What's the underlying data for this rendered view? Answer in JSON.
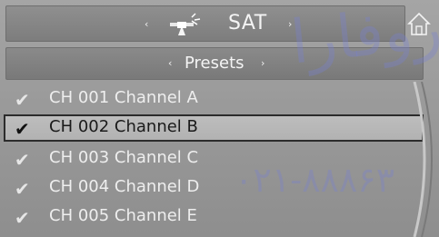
{
  "header": {
    "source_label": "SAT",
    "prev_arrow": "‹",
    "next_arrow": "›"
  },
  "presets": {
    "label": "Presets",
    "prev_arrow": "‹",
    "next_arrow": "›"
  },
  "channels": [
    {
      "label": "CH 001 Channel A",
      "selected": false
    },
    {
      "label": "CH 002 Channel B",
      "selected": true
    },
    {
      "label": "CH 003 Channel C",
      "selected": false
    },
    {
      "label": "CH 004 Channel D",
      "selected": false
    },
    {
      "label": "CH 005 Channel E",
      "selected": false
    }
  ],
  "watermark": {
    "line1": "روفارا",
    "line2": "۰۲۱-۸۸۸۶۳"
  }
}
